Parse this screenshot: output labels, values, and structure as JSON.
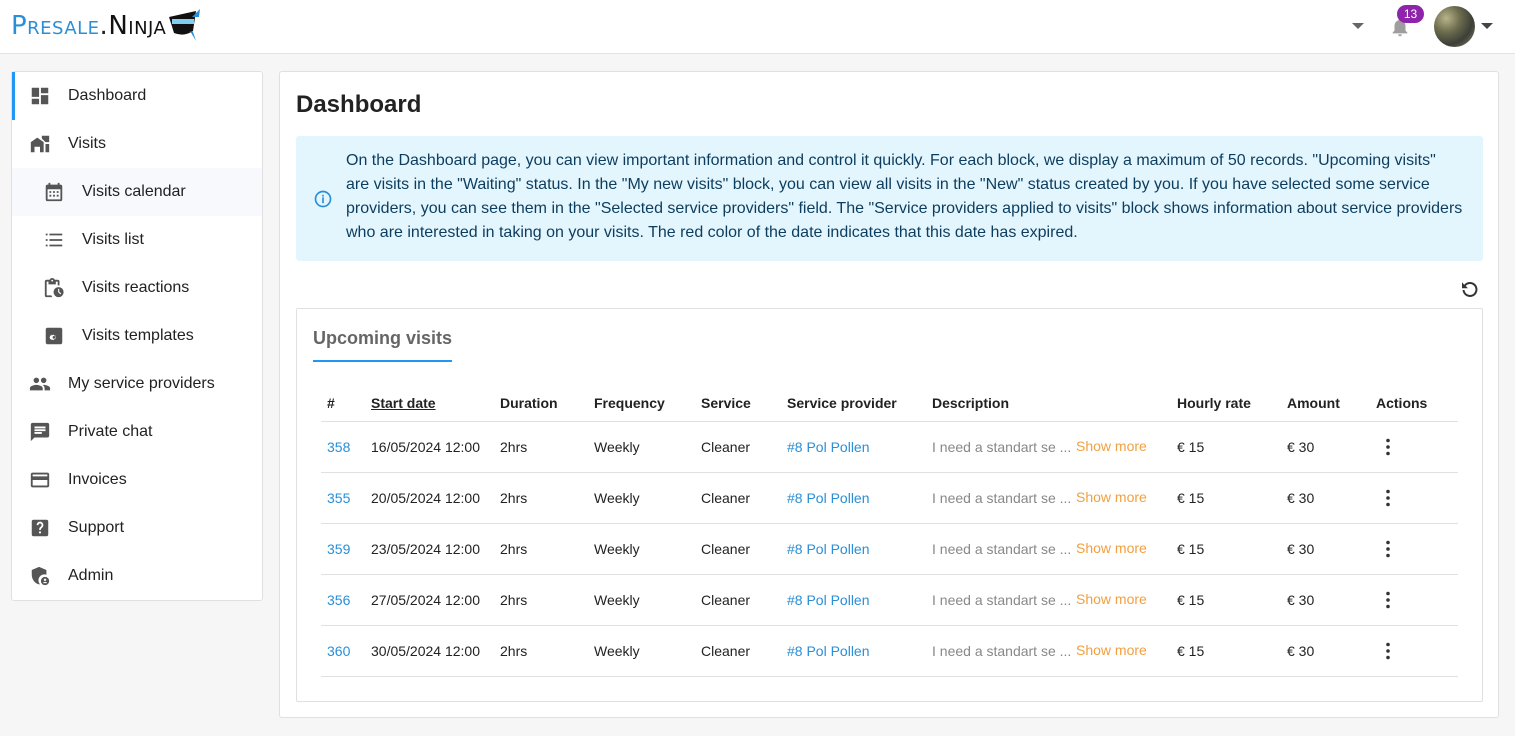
{
  "header": {
    "logo_part1": "Presale",
    "logo_dot": ".",
    "logo_part2": "Ninja",
    "notification_count": "13"
  },
  "sidebar": {
    "items": [
      {
        "label": "Dashboard",
        "icon": "dashboard-icon"
      },
      {
        "label": "Visits",
        "icon": "visits-icon"
      },
      {
        "label": "Visits calendar",
        "icon": "calendar-icon"
      },
      {
        "label": "Visits list",
        "icon": "list-icon"
      },
      {
        "label": "Visits reactions",
        "icon": "clipboard-clock-icon"
      },
      {
        "label": "Visits templates",
        "icon": "template-icon"
      },
      {
        "label": "My service providers",
        "icon": "people-icon"
      },
      {
        "label": "Private chat",
        "icon": "chat-icon"
      },
      {
        "label": "Invoices",
        "icon": "card-icon"
      },
      {
        "label": "Support",
        "icon": "help-icon"
      },
      {
        "label": "Admin",
        "icon": "admin-shield-icon"
      }
    ]
  },
  "main": {
    "title": "Dashboard",
    "info": "On the Dashboard page, you can view important information and control it quickly. For each block, we display a maximum of 50 records. \"Upcoming visits\" are visits in the \"Waiting\" status. In the \"My new visits\" block, you can view all visits in the \"New\" status created by you. If you have selected some service providers, you can see them in the \"Selected service providers\" field. The \"Service providers applied to visits\" block shows information about service providers who are interested in taking on your visits. The red color of the date indicates that this date has expired.",
    "tab_label": "Upcoming visits",
    "table": {
      "headers": [
        "#",
        "Start date",
        "Duration",
        "Frequency",
        "Service",
        "Service provider",
        "Description",
        "Hourly rate",
        "Amount",
        "Actions"
      ],
      "show_more": "Show more",
      "rows": [
        {
          "id": "358",
          "start": "16/05/2024 12:00",
          "duration": "2hrs",
          "frequency": "Weekly",
          "service": "Cleaner",
          "provider": "#8 Pol Pollen",
          "description": "I need a standart se ...",
          "rate": "€ 15",
          "amount": "€ 30"
        },
        {
          "id": "355",
          "start": "20/05/2024 12:00",
          "duration": "2hrs",
          "frequency": "Weekly",
          "service": "Cleaner",
          "provider": "#8 Pol Pollen",
          "description": "I need a standart se ...",
          "rate": "€ 15",
          "amount": "€ 30"
        },
        {
          "id": "359",
          "start": "23/05/2024 12:00",
          "duration": "2hrs",
          "frequency": "Weekly",
          "service": "Cleaner",
          "provider": "#8 Pol Pollen",
          "description": "I need a standart se ...",
          "rate": "€ 15",
          "amount": "€ 30"
        },
        {
          "id": "356",
          "start": "27/05/2024 12:00",
          "duration": "2hrs",
          "frequency": "Weekly",
          "service": "Cleaner",
          "provider": "#8 Pol Pollen",
          "description": "I need a standart se ...",
          "rate": "€ 15",
          "amount": "€ 30"
        },
        {
          "id": "360",
          "start": "30/05/2024 12:00",
          "duration": "2hrs",
          "frequency": "Weekly",
          "service": "Cleaner",
          "provider": "#8 Pol Pollen",
          "description": "I need a standart se ...",
          "rate": "€ 15",
          "amount": "€ 30"
        }
      ]
    }
  },
  "colors": {
    "accent": "#2196f3",
    "link": "#2a8fd6",
    "show_more": "#f0a040",
    "badge": "#8e24aa",
    "info_bg": "#e3f5fd"
  }
}
